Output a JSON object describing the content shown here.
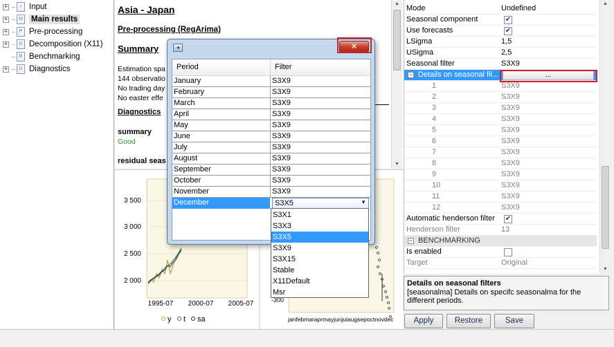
{
  "tree": [
    {
      "label": "Input",
      "icon": "I",
      "expander": "+"
    },
    {
      "label": "Main results",
      "icon": "M",
      "expander": "+",
      "selected": true
    },
    {
      "label": "Pre-processing",
      "icon": "P",
      "expander": "+"
    },
    {
      "label": "Decomposition (X11)",
      "icon": "D",
      "expander": "+"
    },
    {
      "label": "Benchmarking",
      "icon": "B",
      "expander": ""
    },
    {
      "label": "Diagnostics",
      "icon": "D",
      "expander": "+"
    }
  ],
  "doc": {
    "title": "Asia - Japan",
    "subtitle": "Pre-processing (RegArima)",
    "summary_heading": "Summary",
    "lines": [
      "Estimation spa",
      "144 observatio",
      "No trading day",
      "No easter effe"
    ],
    "diagnostics_heading": "Diagnostics",
    "summary_label": "summary",
    "summary_value": "Good",
    "residual_label": "residual seas"
  },
  "chart_left": {
    "yticks": [
      "3 500",
      "3 000",
      "2 500",
      "2 000"
    ],
    "xticks": [
      "1995-07",
      "2000-07",
      "2005-07"
    ],
    "legend": [
      {
        "name": "y",
        "color": "#c8a040"
      },
      {
        "name": "t",
        "color": "#2e7d32"
      },
      {
        "name": "sa",
        "color": "#1a237e"
      }
    ]
  },
  "chart_right": {
    "ytick": "-300",
    "xticks": "janfebmaraprmayjunjulaugsepoctnovdec"
  },
  "props": {
    "rows": [
      {
        "name": "Mode",
        "value": "Undefined"
      },
      {
        "name": "Seasonal component",
        "check": "✔"
      },
      {
        "name": "Use forecasts",
        "check": "✔"
      },
      {
        "name": "LSigma",
        "value": "1,5"
      },
      {
        "name": "USigma",
        "value": "2,5"
      },
      {
        "name": "Seasonal filter",
        "value": "S3X9"
      }
    ],
    "details_label": "Details on seasonal fil...",
    "details_button": "...",
    "subrows": [
      {
        "name": "1",
        "value": "S3X9"
      },
      {
        "name": "2",
        "value": "S3X9"
      },
      {
        "name": "3",
        "value": "S3X9"
      },
      {
        "name": "4",
        "value": "S3X9"
      },
      {
        "name": "5",
        "value": "S3X9"
      },
      {
        "name": "6",
        "value": "S3X9"
      },
      {
        "name": "7",
        "value": "S3X9"
      },
      {
        "name": "8",
        "value": "S3X9"
      },
      {
        "name": "9",
        "value": "S3X9"
      },
      {
        "name": "10",
        "value": "S3X9"
      },
      {
        "name": "11",
        "value": "S3X9"
      },
      {
        "name": "12",
        "value": "S3X9"
      }
    ],
    "auto_henderson_label": "Automatic henderson filter",
    "auto_henderson_check": "✔",
    "henderson_label": "Henderson filter",
    "henderson_value": "13",
    "benchmarking_label": "BENCHMARKING",
    "is_enabled_label": "Is enabled",
    "target_label": "Target",
    "target_value": "Original"
  },
  "description": {
    "title": "Details on seasonal filters",
    "text": "[seasonalma] Details on specifc seasonalma for the different periods."
  },
  "buttons": {
    "apply": "Apply",
    "restore": "Restore",
    "save": "Save"
  },
  "dialog": {
    "close": "✕",
    "col_period": "Period",
    "col_filter": "Filter",
    "rows": [
      {
        "period": "January",
        "filter": "S3X9"
      },
      {
        "period": "February",
        "filter": "S3X9"
      },
      {
        "period": "March",
        "filter": "S3X9"
      },
      {
        "period": "April",
        "filter": "S3X9"
      },
      {
        "period": "May",
        "filter": "S3X9"
      },
      {
        "period": "June",
        "filter": "S3X9"
      },
      {
        "period": "July",
        "filter": "S3X9"
      },
      {
        "period": "August",
        "filter": "S3X9"
      },
      {
        "period": "September",
        "filter": "S3X9"
      },
      {
        "period": "October",
        "filter": "S3X9"
      },
      {
        "period": "November",
        "filter": "S3X9"
      }
    ],
    "selected_row": {
      "period": "December",
      "filter": "S3X5"
    },
    "dropdown_options": [
      "S3X1",
      "S3X3",
      "S3X5",
      "S3X9",
      "S3X15",
      "Stable",
      "X11Default",
      "Msr"
    ],
    "dropdown_selected": "S3X5"
  },
  "colors": {
    "selection": "#3399ff",
    "highlight_box": "#cc1f2f",
    "good": "#2e8b2e"
  }
}
